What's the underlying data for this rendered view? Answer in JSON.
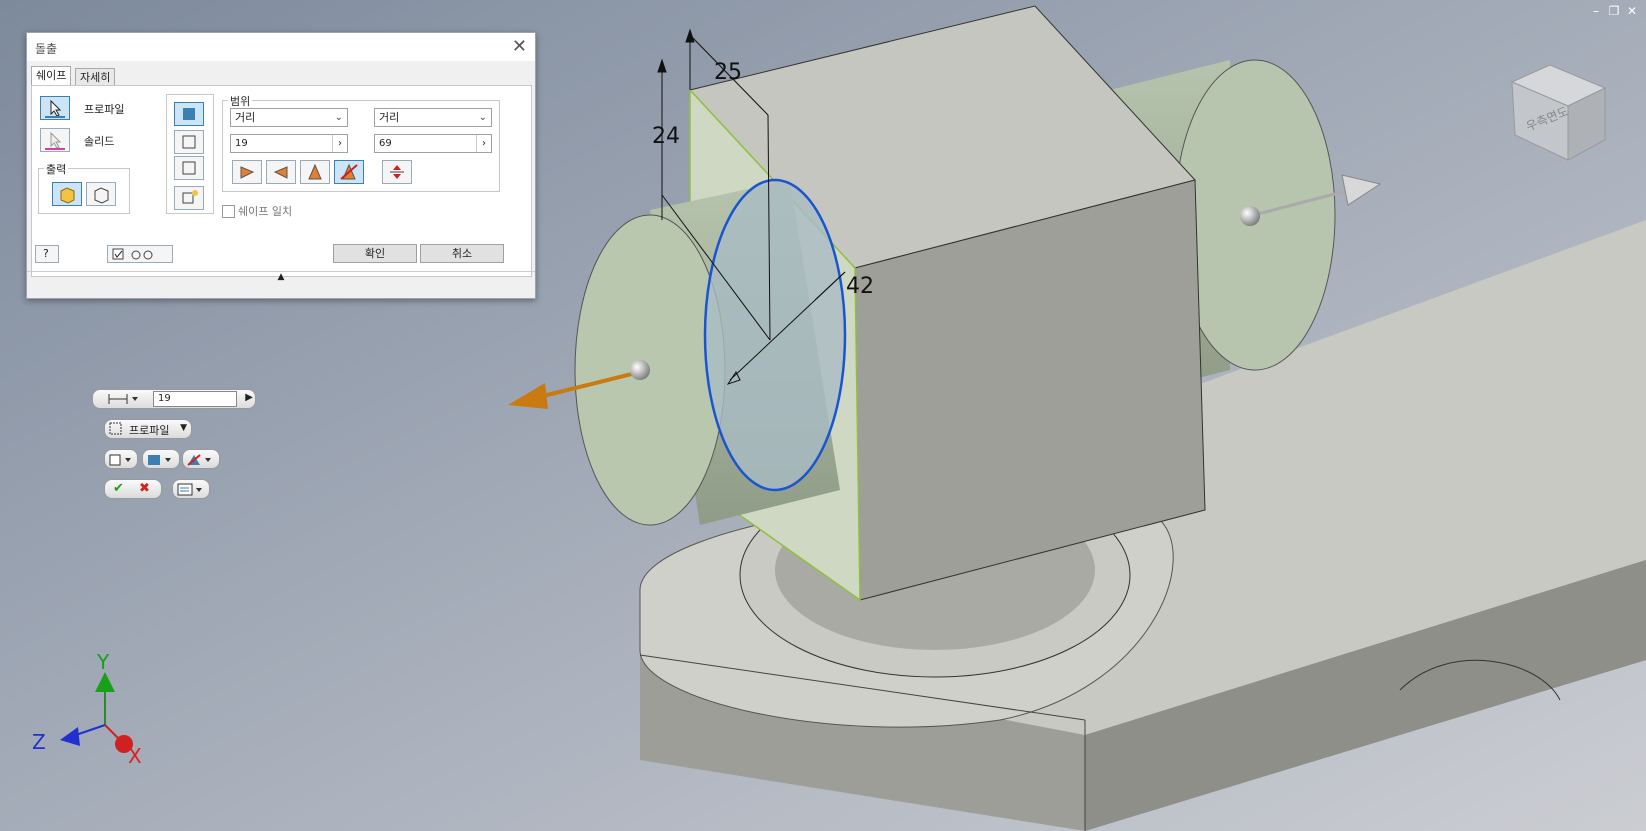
{
  "window": {
    "minimize": "–",
    "restore": "❐",
    "close": "✕"
  },
  "dialog": {
    "title": "돌출",
    "close_glyph": "✕",
    "tabs": [
      {
        "label": "쉐이프"
      },
      {
        "label": "자세히"
      }
    ],
    "profile_label": "프로파일",
    "solid_label": "솔리드",
    "output_label": "출력",
    "extent_label": "범위",
    "extent_type_1": "거리",
    "extent_type_2": "거리",
    "distance_1": "19",
    "distance_2": "69",
    "match_shape_label": "쉐이프 일치",
    "ok_label": "확인",
    "cancel_label": "취소",
    "collapse_glyph": "▲",
    "help_glyph": "?"
  },
  "mini_toolbar": {
    "distance_value": "19",
    "profile_label": "프로파일"
  },
  "dimensions": {
    "d1": "25",
    "d2": "24",
    "d3": "42"
  },
  "viewcube": {
    "label": "우측면도"
  },
  "axes": {
    "x": "X",
    "y": "Y",
    "z": "Z"
  },
  "colors": {
    "accent_blue": "#3c7fb1",
    "arrow_orange": "#c97a10",
    "sketch_blue": "#1a55d0",
    "axis_x": "#e02020",
    "axis_y": "#18a018",
    "axis_z": "#2030d0"
  }
}
